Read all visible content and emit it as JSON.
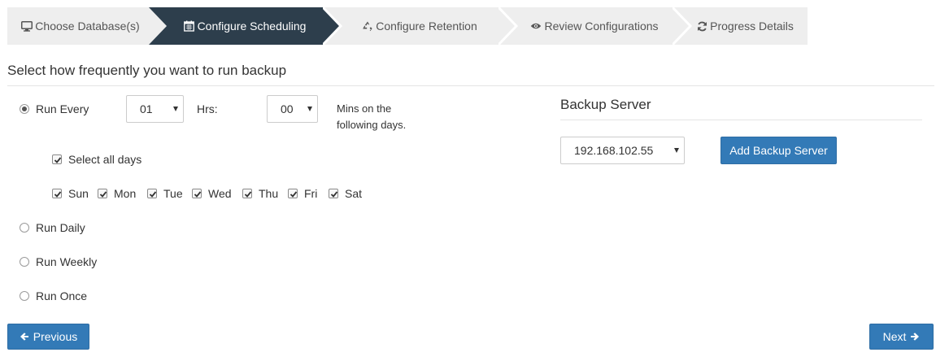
{
  "wizard": {
    "steps": [
      {
        "label": "Choose Database(s)",
        "icon": "monitor-icon"
      },
      {
        "label": "Configure Scheduling",
        "icon": "calendar-icon"
      },
      {
        "label": "Configure Retention",
        "icon": "recycle-icon"
      },
      {
        "label": "Review Configurations",
        "icon": "eye-icon"
      },
      {
        "label": "Progress Details",
        "icon": "refresh-icon"
      }
    ],
    "active_index": 1,
    "colors": {
      "inactive": "#eeeeee",
      "active": "#2d3e4c"
    }
  },
  "schedule": {
    "title": "Select how frequently you want to run backup",
    "run_every_label": "Run Every",
    "hours_value": "01",
    "hrs_label": "Hrs:",
    "mins_value": "00",
    "mins_line1": "Mins on the",
    "mins_line2": "following days.",
    "select_all_label": "Select all days",
    "days": [
      "Sun",
      "Mon",
      "Tue",
      "Wed",
      "Thu",
      "Fri",
      "Sat"
    ],
    "run_daily_label": "Run Daily",
    "run_weekly_label": "Run Weekly",
    "run_once_label": "Run Once",
    "selected_option": "Run Every"
  },
  "backup_server": {
    "title": "Backup Server",
    "selected": "192.168.102.55",
    "add_label": "Add Backup Server"
  },
  "nav": {
    "previous_label": "Previous",
    "next_label": "Next",
    "accent": "#337ab7"
  }
}
